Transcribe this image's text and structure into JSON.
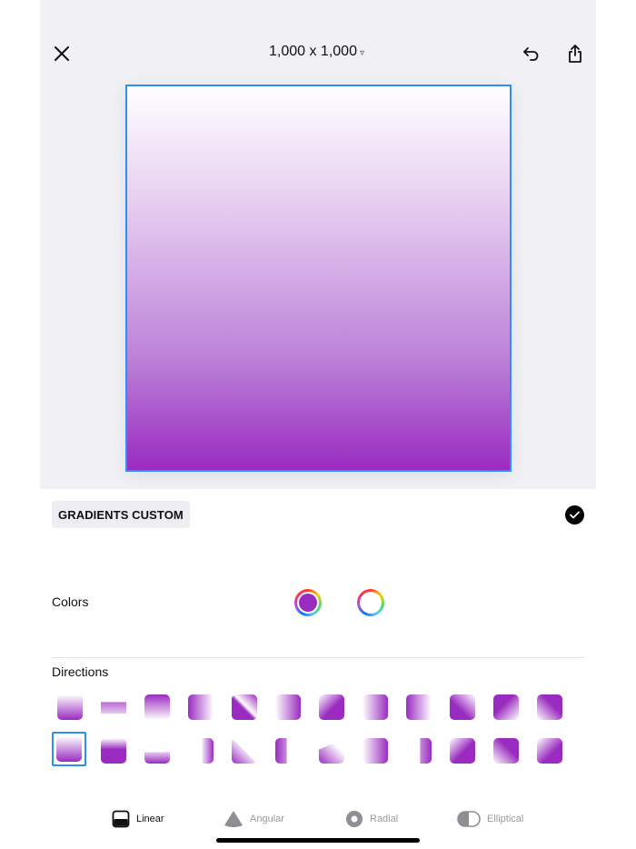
{
  "topbar": {
    "close_icon": "close-icon",
    "canvas_size": "1,000 x 1,000",
    "size_dropdown_icon": "▿",
    "undo_icon": "undo-icon",
    "share_icon": "share-icon"
  },
  "canvas": {
    "gradient_stops": [
      "#ffffff",
      "#e2c6ee",
      "#bd84d9",
      "#9a2bc0"
    ]
  },
  "panel": {
    "title": "GRADIENTS CUSTOM",
    "confirm_icon": "checkmark-icon",
    "colors_label": "Colors",
    "color_1": "#9a2bc0",
    "color_2": "#ffffff",
    "directions_label": "Directions"
  },
  "tabs": [
    {
      "label": "Linear",
      "icon": "linear-gradient-icon",
      "active": true
    },
    {
      "label": "Angular",
      "icon": "angular-gradient-icon",
      "active": false
    },
    {
      "label": "Radial",
      "icon": "radial-gradient-icon",
      "active": false
    },
    {
      "label": "Elliptical",
      "icon": "elliptical-gradient-icon",
      "active": false
    }
  ],
  "colors": {
    "accent_selection": "#2f8ff0",
    "gradient_end": "#9a2bc0",
    "inactive_tab_text": "#9a9a9a"
  }
}
